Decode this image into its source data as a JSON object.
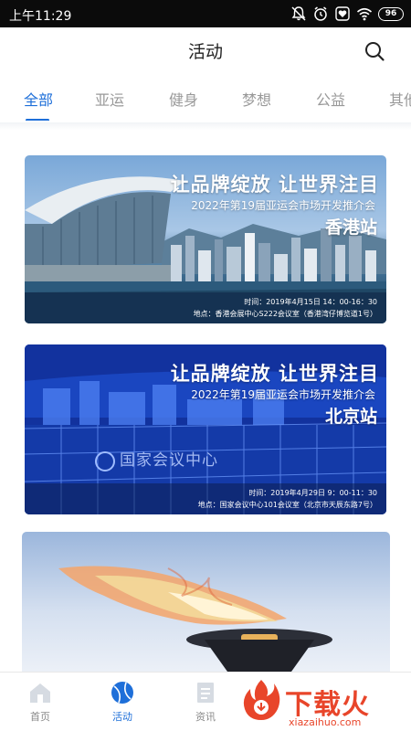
{
  "status_bar": {
    "time": "上午11:29",
    "battery": "96"
  },
  "header": {
    "title": "活动"
  },
  "tabs": [
    {
      "label": "全部",
      "active": true
    },
    {
      "label": "亚运",
      "active": false
    },
    {
      "label": "健身",
      "active": false
    },
    {
      "label": "梦想",
      "active": false
    },
    {
      "label": "公益",
      "active": false
    },
    {
      "label": "其他",
      "active": false
    }
  ],
  "cards": [
    {
      "headline": "让品牌绽放 让世界注目",
      "subtitle": "2022年第19届亚运会市场开发推介会",
      "city": "香港站",
      "time": "时间：2019年4月15日  14：00-16：30",
      "venue": "地点：香港会展中心S222会议室（香港湾仔博览道1号）"
    },
    {
      "headline": "让品牌绽放 让世界注目",
      "subtitle": "2022年第19届亚运会市场开发推介会",
      "city": "北京站",
      "time": "时间：2019年4月29日  9：00-11：30",
      "venue": "地点：国家会议中心101会议室（北京市天辰东路7号）",
      "building_sign": "国家会议中心"
    }
  ],
  "bottom_nav": [
    {
      "label": "首页",
      "icon": "home-icon",
      "active": false
    },
    {
      "label": "活动",
      "icon": "ball-icon",
      "active": true
    },
    {
      "label": "资讯",
      "icon": "document-icon",
      "active": false
    }
  ],
  "watermark": {
    "text": "下载火",
    "domain": "xiazaihuo.com"
  },
  "colors": {
    "accent": "#1e6fd9",
    "status_bar": "#0b0b0b",
    "watermark": "#e8452a"
  }
}
